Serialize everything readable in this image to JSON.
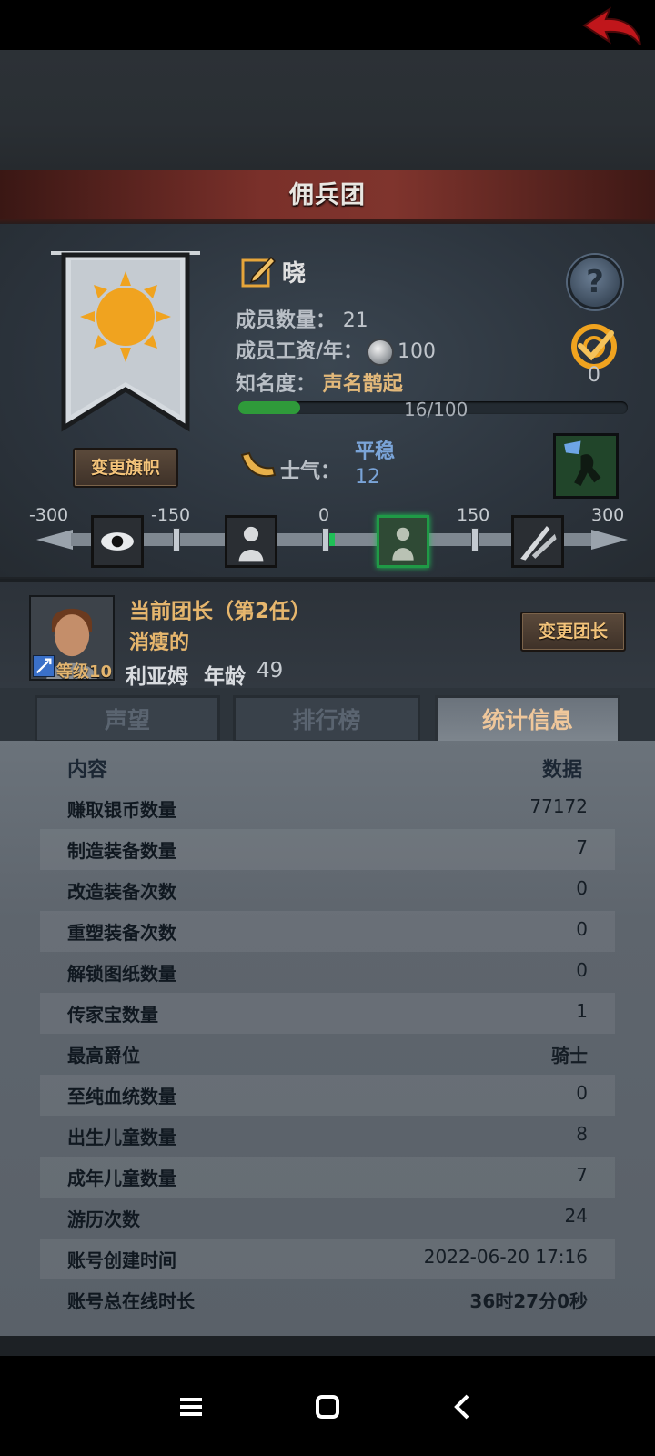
{
  "header": {
    "title": "佣兵团"
  },
  "banner": {
    "change_label": "变更旗帜"
  },
  "team": {
    "name": "晓",
    "members_label": "成员数量：",
    "members_value": "21",
    "wage_label": "成员工资/年：",
    "wage_value": "100",
    "fame_label": "知名度：",
    "fame_value": "声名鹊起",
    "fame_progress_text": "16/100",
    "fame_progress": 0.16,
    "task_count": "0"
  },
  "morale": {
    "label": "士气：",
    "state": "平稳",
    "value": "12",
    "scale_labels": [
      "-300",
      "-150",
      "0",
      "150",
      "300"
    ]
  },
  "leader": {
    "role": "当前团长（第2任）",
    "trait": "消瘦的",
    "name": "利亚姆",
    "age_label": "年龄",
    "age": "49",
    "level": "等级10",
    "change_label": "变更团长"
  },
  "tabs": [
    {
      "label": "声望"
    },
    {
      "label": "排行榜"
    },
    {
      "label": "统计信息"
    }
  ],
  "table": {
    "col_left": "内容",
    "col_right": "数据",
    "rows": [
      {
        "k": "赚取银币数量",
        "v": "77172"
      },
      {
        "k": "制造装备数量",
        "v": "7"
      },
      {
        "k": "改造装备次数",
        "v": "0"
      },
      {
        "k": "重塑装备次数",
        "v": "0"
      },
      {
        "k": "解锁图纸数量",
        "v": "0"
      },
      {
        "k": "传家宝数量",
        "v": "1"
      },
      {
        "k": "最高爵位",
        "v": "骑士"
      },
      {
        "k": "至纯血统数量",
        "v": "0"
      },
      {
        "k": "出生儿童数量",
        "v": "8"
      },
      {
        "k": "成年儿童数量",
        "v": "7"
      },
      {
        "k": "游历次数",
        "v": "24"
      },
      {
        "k": "账号创建时间",
        "v": "2022-06-20 17:16"
      },
      {
        "k": "账号总在线时长",
        "v": "36时27分0秒"
      }
    ]
  },
  "icons": {
    "back": "back-arrow-icon",
    "edit": "edit-pencil-icon",
    "help": "question-icon",
    "task": "target-check-icon",
    "coin": "silver-coin-icon",
    "horn": "horn-icon",
    "nav": [
      "menu-icon",
      "home-icon",
      "back-icon"
    ]
  },
  "colors": {
    "accent_gold": "#e6b66d",
    "morale_blue": "#7aa4d8",
    "header_red": "#7a302a",
    "progress_green": "#2f9a3a"
  }
}
